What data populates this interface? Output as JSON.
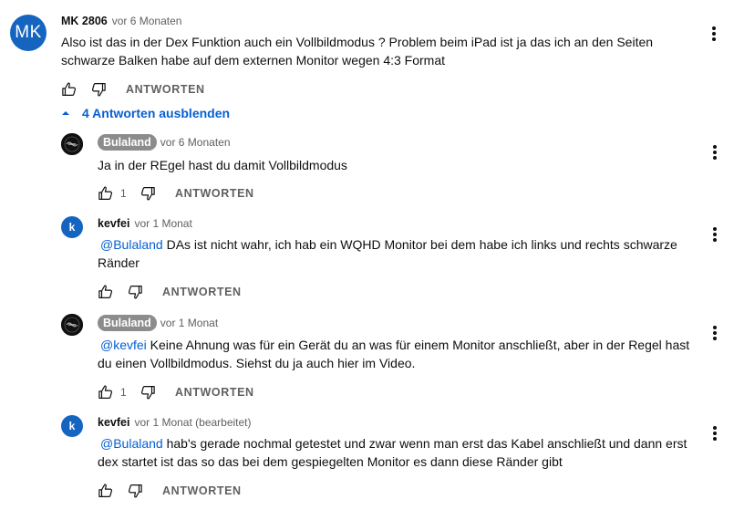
{
  "main_comment": {
    "avatar_initials": "MK",
    "author": "MK 2806",
    "time": "vor 6 Monaten",
    "text_line1": "Also ist das in der Dex Funktion auch ein Vollbildmodus ? Problem beim iPad ist ja das ich an den Seiten",
    "text_line2": "schwarze Balken habe auf dem externen Monitor wegen 4:3 Format",
    "like_count": "",
    "reply_label": "ANTWORTEN"
  },
  "replies_toggle": {
    "label": "4 Antworten ausblenden"
  },
  "replies": [
    {
      "author": "Bulaland",
      "time": "vor 6 Monaten",
      "mention": "",
      "text_line1": "Ja in der REgel hast du damit Vollbildmodus",
      "text_line2": "",
      "like_count": "1",
      "reply_label": "ANTWORTEN"
    },
    {
      "avatar_initial": "k",
      "author": "kevfei",
      "time": "vor 1 Monat",
      "mention": "@Bulaland",
      "text_line1": " DAs ist nicht wahr, ich hab ein WQHD Monitor bei dem habe ich links und rechts schwarze",
      "text_line2": "Ränder",
      "like_count": "",
      "reply_label": "ANTWORTEN"
    },
    {
      "author": "Bulaland",
      "time": "vor 1 Monat",
      "mention": "@kevfei",
      "text_line1": " Keine Ahnung was für ein Gerät du an was für einem Monitor anschließt, aber in der Regel hast",
      "text_line2": "du einen Vollbildmodus. Siehst du ja auch hier im Video.",
      "like_count": "1",
      "reply_label": "ANTWORTEN"
    },
    {
      "avatar_initial": "k",
      "author": "kevfei",
      "time": "vor 1 Monat (bearbeitet)",
      "mention": "@Bulaland",
      "text_line1": " hab's gerade nochmal getestet und zwar wenn man erst das Kabel anschließt und dann erst",
      "text_line2": "dex startet ist das so das bei dem gespiegelten Monitor es dann diese Ränder gibt",
      "like_count": "",
      "reply_label": "ANTWORTEN"
    }
  ],
  "colors": {
    "link_blue": "#065fd4",
    "avatar_blue": "#1565c0",
    "secondary_text": "#606060",
    "pill_gray": "#8c8c8c"
  },
  "icons": {
    "like": "thumb-up-icon",
    "dislike": "thumb-down-icon",
    "menu": "more-vert-icon",
    "toggle": "chevron-up-icon"
  }
}
